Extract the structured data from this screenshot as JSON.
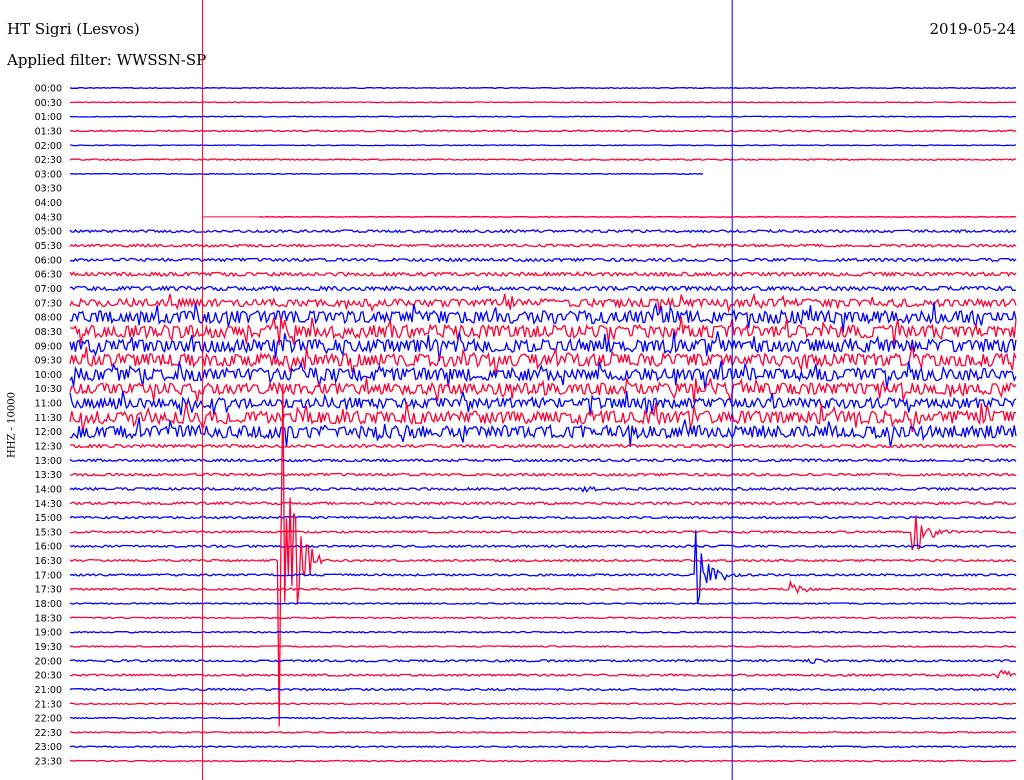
{
  "header": {
    "station": "HT Sigri (Lesvos)",
    "filter": "Applied filter: WWSSN-SP",
    "date": "2019-05-24"
  },
  "chart_data": {
    "type": "line",
    "title": "HT Sigri (Lesvos)",
    "ylabel": "HHZ - 10000",
    "row_labels": [
      "00:00",
      "00:30",
      "01:00",
      "01:30",
      "02:00",
      "02:30",
      "03:00",
      "03:30",
      "04:00",
      "04:30",
      "05:00",
      "05:30",
      "06:00",
      "06:30",
      "07:00",
      "07:30",
      "08:00",
      "08:30",
      "09:00",
      "09:30",
      "10:00",
      "10:30",
      "11:00",
      "11:30",
      "12:00",
      "12:30",
      "13:00",
      "13:30",
      "14:00",
      "14:30",
      "15:00",
      "15:30",
      "16:00",
      "16:30",
      "17:00",
      "17:30",
      "18:00",
      "18:30",
      "19:00",
      "19:30",
      "20:00",
      "20:30",
      "21:00",
      "21:30",
      "22:00",
      "22:30",
      "23:00",
      "23:30"
    ],
    "trace_colors": [
      "#0000ff",
      "#ff0033"
    ],
    "data_gap": {
      "from_row": 6,
      "from_fraction": 0.67,
      "to_row": 9,
      "to_fraction": 0.2
    },
    "row_noise_level": [
      0.3,
      0.3,
      0.3,
      0.6,
      0.3,
      0.5,
      0.3,
      0,
      0,
      0.3,
      1,
      1,
      1.2,
      1.5,
      1.6,
      3,
      5,
      5,
      5,
      5,
      5,
      4.5,
      4,
      5,
      5,
      1.2,
      1,
      1,
      1,
      1,
      0.8,
      0.8,
      0.8,
      0.8,
      0.8,
      0.8,
      0.5,
      0.5,
      0.5,
      0.5,
      0.8,
      0.8,
      0.8,
      0.5,
      0.5,
      0.5,
      0.5,
      0.5
    ],
    "events": [
      {
        "row": 33,
        "time_fraction": 0.22,
        "amplitude": 300,
        "label": ""
      },
      {
        "row": 34,
        "time_fraction": 0.66,
        "amplitude": 75,
        "label": ""
      },
      {
        "row": 31,
        "time_fraction": 0.89,
        "amplitude": 45,
        "label": ""
      },
      {
        "row": 35,
        "time_fraction": 0.76,
        "amplitude": 10,
        "label": ""
      },
      {
        "row": 41,
        "time_fraction": 0.98,
        "amplitude": 8,
        "label": ""
      },
      {
        "row": 40,
        "time_fraction": 0.78,
        "amplitude": 4,
        "label": ""
      },
      {
        "row": 28,
        "time_fraction": 0.54,
        "amplitude": 4,
        "label": ""
      }
    ],
    "markers": [
      {
        "color": "#ff0033",
        "time_fraction": 0.14
      },
      {
        "color": "#0000ff",
        "time_fraction": 0.7
      }
    ],
    "grid": false,
    "legend": "none"
  }
}
